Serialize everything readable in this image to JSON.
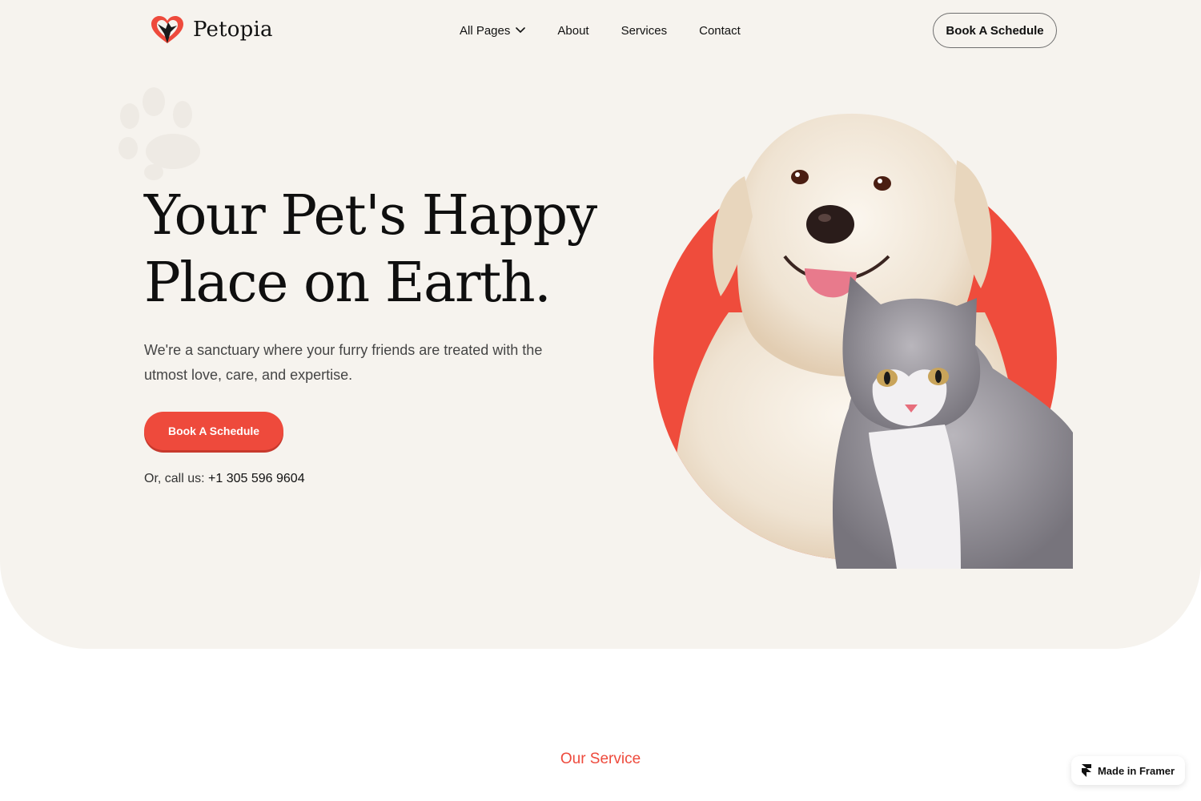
{
  "brand": {
    "name": "Petopia",
    "logo_icon": "heart-pet-icon",
    "accent_color": "#ee4a3c"
  },
  "nav": {
    "items": [
      {
        "label": "All Pages",
        "has_dropdown": true
      },
      {
        "label": "About"
      },
      {
        "label": "Services"
      },
      {
        "label": "Contact"
      }
    ],
    "cta_label": "Book A Schedule"
  },
  "hero": {
    "headline_line1": "Your Pet's Happy",
    "headline_line2": "Place on Earth.",
    "subtitle": "We're a sanctuary where your furry friends are treated with the utmost love, care, and expertise.",
    "cta_label": "Book A Schedule",
    "call_prefix": "Or, call us:",
    "phone": "+1 305 596 9604",
    "image": "dog-and-cat-illustration",
    "background_color": "#f6f3ee"
  },
  "services": {
    "label": "Our Service"
  },
  "badge": {
    "label": "Made in Framer",
    "icon": "framer-icon"
  }
}
